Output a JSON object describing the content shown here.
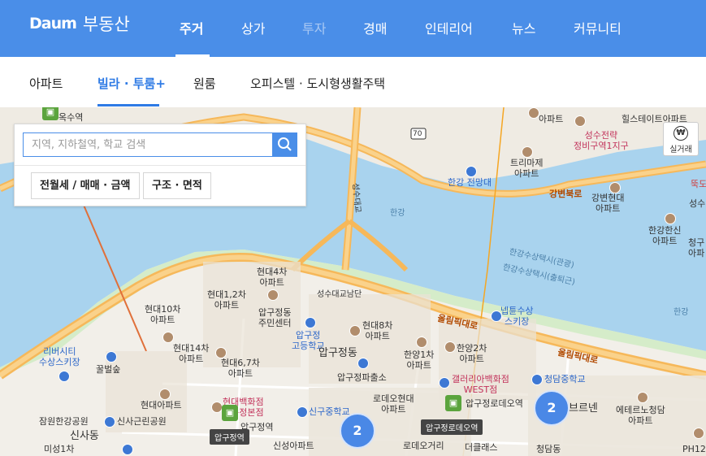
{
  "header": {
    "brand": "Daum",
    "service": "부동산",
    "nav": [
      "주거",
      "상가",
      "투자",
      "경매",
      "인테리어",
      "뉴스",
      "커뮤니티"
    ],
    "active": "주거"
  },
  "subnav": {
    "items": [
      "아파트",
      "빌라 · 투룸+",
      "원룸",
      "오피스텔 · 도시형생활주택"
    ],
    "active": "빌라 · 투룸+"
  },
  "search": {
    "placeholder": "지역, 지하철역, 학교 검색",
    "filters": [
      "전월세 / 매매 · 금액",
      "구조 · 면적"
    ]
  },
  "map_controls": {
    "realdeal_label": "실거래",
    "realdeal_icon": "won-icon"
  },
  "map": {
    "clusters": [
      "2",
      "2"
    ],
    "stations": [
      "압구정역",
      "압구정로데오역"
    ],
    "labels": {
      "oksu": "옥수역",
      "apt_top": "아파트",
      "hillstate": "힐스테이트아파트",
      "seongsu": "성수전략\n정비구역1지구",
      "trimage": "트리마제\n아파트",
      "hangang_cafe": "한강 전망대",
      "gangbyeon": "강변북로",
      "gangbyeon_hd": "강변현대\n아파트",
      "hangang_hanshin": "한강한신\n아파트",
      "cheonggu": "청구\n아파",
      "seongsu2": "성수",
      "ttukdo": "뚝도",
      "hangang": "한강",
      "water_taxi1": "한강수상택시(관광)",
      "water_taxi2": "한강수상택시(출퇴근)",
      "hangang2": "한강",
      "bridge": "성수대교남단",
      "seongsu_bridge": "성수대교",
      "olympic": "올림픽대로",
      "olympic2": "올림픽대로",
      "hyundai4": "현대4차\n아파트",
      "hyundai12": "현대1,2차\n아파트",
      "apgujeong_center": "압구정동\n주민센터",
      "hyundai10": "현대10차\n아파트",
      "apgujeong_hs": "압구정\n고등학교",
      "apgujeong_dong": "압구정동",
      "hyundai8": "현대8차\n아파트",
      "hanyang1": "한양1차\n아파트",
      "hanyang2": "한양2차\n아파트",
      "hyundai14": "현대14차\n아파트",
      "hyundai67": "현대6,7차\n아파트",
      "apgujeong_office": "압구정파출소",
      "river_scholar": "리버시티\n수상스키장",
      "ggulbeoseul": "꿀벌숲",
      "nebeul": "넵튠수상\n스키장",
      "galleria": "갤러리아백화점\nWEST점",
      "cheongdam_ms": "청담중학교",
      "hyundai_apt": "현대아파트",
      "hyundai_dept": "현대백화점\n압구정본점",
      "sinsa_ms": "신구중학교",
      "rodeo_hd": "로데오현대\n아파트",
      "apgujeong_rodeo": "압구정로데오역",
      "hanshin": "압구정역",
      "sinsung": "신성아파트",
      "brennen": "브르넨",
      "etrenos": "에테르노청담\n아파트",
      "jamwon": "잠원한강공원",
      "sinsa_park": "신사근린공원",
      "sinsadong": "신사동",
      "misung": "미성1차",
      "rodeo_st": "로데오거리",
      "the_class": "더클래스",
      "cheongdam": "청담동",
      "ph": "PH12",
      "apgujeong_st_lbl": "압구정역",
      "road70": "70",
      "bridge_vert": "성수대교"
    }
  }
}
